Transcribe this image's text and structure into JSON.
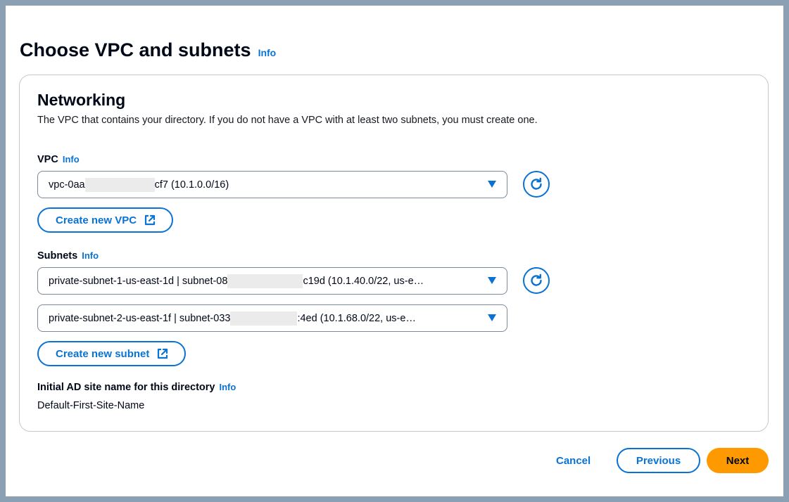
{
  "page": {
    "title": "Choose VPC and subnets",
    "info_label": "Info"
  },
  "networking": {
    "title": "Networking",
    "description": "The VPC that contains your directory. If you do not have a VPC with at least two subnets, you must create one.",
    "vpc": {
      "label": "VPC",
      "info_label": "Info",
      "value_prefix": "vpc-0aa",
      "value_suffix": "cf7 (10.1.0.0/16)"
    },
    "create_vpc_label": "Create new VPC",
    "subnets": {
      "label": "Subnets",
      "info_label": "Info",
      "items": [
        {
          "prefix": "private-subnet-1-us-east-1d | subnet-08",
          "suffix": "c19d (10.1.40.0/22, us-e…"
        },
        {
          "prefix": "private-subnet-2-us-east-1f | subnet-033",
          "suffix": ":4ed (10.1.68.0/22, us-e…"
        }
      ]
    },
    "create_subnet_label": "Create new subnet",
    "ad_site": {
      "label": "Initial AD site name for this directory",
      "info_label": "Info",
      "value": "Default-First-Site-Name"
    }
  },
  "footer": {
    "cancel_label": "Cancel",
    "previous_label": "Previous",
    "next_label": "Next"
  },
  "colors": {
    "accent": "#0972d3",
    "primary_button": "#ff9900",
    "frame_border": "#8ba1b3"
  },
  "icons": {
    "refresh": "refresh-icon",
    "external": "external-link-icon",
    "dropdown": "caret-down-icon"
  }
}
